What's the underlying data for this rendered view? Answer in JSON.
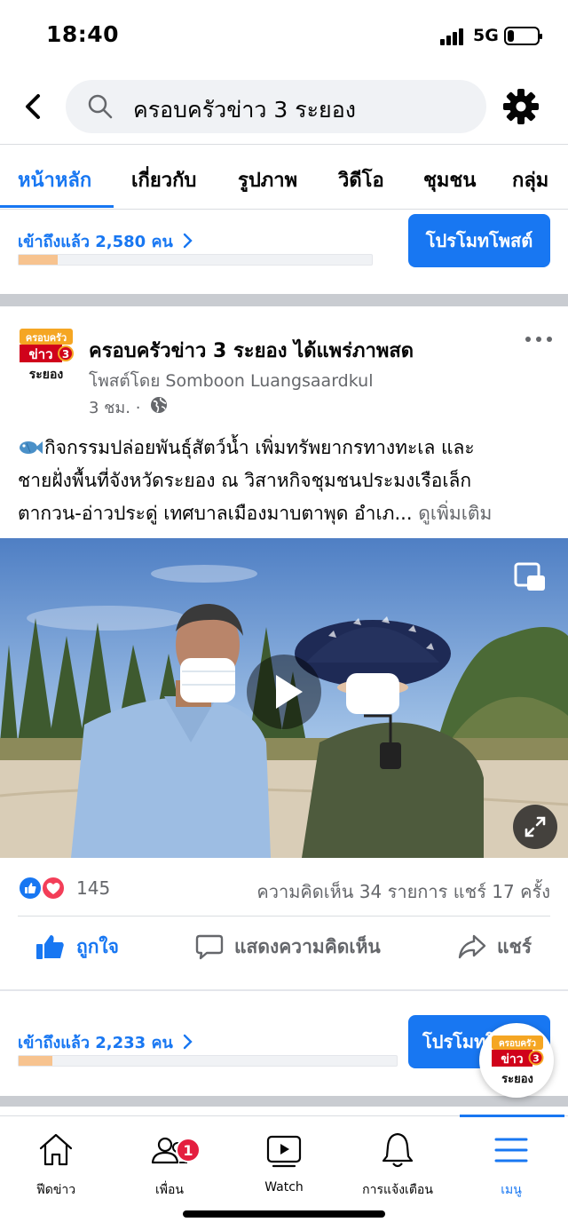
{
  "status_bar": {
    "time": "18:40",
    "network": "5G",
    "battery_level": 0.3
  },
  "search": {
    "query": "ครอบครัวข่าว 3 ระยอง"
  },
  "tabs": [
    {
      "label": "หน้าหลัก",
      "active": true
    },
    {
      "label": "เกี่ยวกับ"
    },
    {
      "label": "รูปภาพ"
    },
    {
      "label": "วิดีโอ"
    },
    {
      "label": "ชุมชน"
    },
    {
      "label": "กลุ่ม"
    }
  ],
  "promo_top": {
    "reach_text": "เข้าถึงแล้ว 2,580 คน",
    "button_label": "โปรโมทโพสต์",
    "progress": 0.11
  },
  "page_logo": {
    "line1": "ครอบครัว",
    "line2": "ข่าว",
    "line3": "ระยอง",
    "channel_number": "3"
  },
  "post": {
    "page_name": "ครอบครัวข่าว 3 ระยอง",
    "action": "ได้แพร่ภาพสด",
    "author": "โพสต์โดย Somboon Luangsaardkul",
    "time": "3 ชม. ·",
    "body_line1": "กิจกรรมปล่อยพันธุ์สัตว์น้ำ เพิ่มทรัพยากรทางทะเล และ",
    "body_line2": "ชายฝั่งพื้นที่จังหวัดระยอง ณ วิสาหกิจชุมชนประมงเรือเล็ก",
    "body_line3": "ตากวน-อ่าวประดู่ เทศบาลเมืองมาบตาพุด อำเภ...",
    "see_more": "ดูเพิ่มเติม",
    "reaction_count": "145",
    "comments_shares": "ความคิดเห็น 34 รายการ  แชร์ 17 ครั้ง"
  },
  "actions": {
    "like": "ถูกใจ",
    "comment": "แสดงความคิดเห็น",
    "share": "แชร์"
  },
  "promo_bottom": {
    "reach_text": "เข้าถึงแล้ว 2,233 คน",
    "button_label": "โปรโมทโพสต์",
    "progress": 0.09
  },
  "bottom_nav": {
    "items": [
      {
        "label": "ฟีดข่าว",
        "icon": "home-icon"
      },
      {
        "label": "เพื่อน",
        "icon": "friends-icon",
        "badge": "1"
      },
      {
        "label": "Watch",
        "icon": "watch-icon"
      },
      {
        "label": "การแจ้งเตือน",
        "icon": "bell-icon"
      },
      {
        "label": "เมนู",
        "icon": "menu-icon",
        "active": true
      }
    ]
  },
  "colors": {
    "accent": "#1877f2",
    "secondary_text": "#65676b",
    "badge": "#e41e3f",
    "progress_fill": "#f7c38f"
  }
}
